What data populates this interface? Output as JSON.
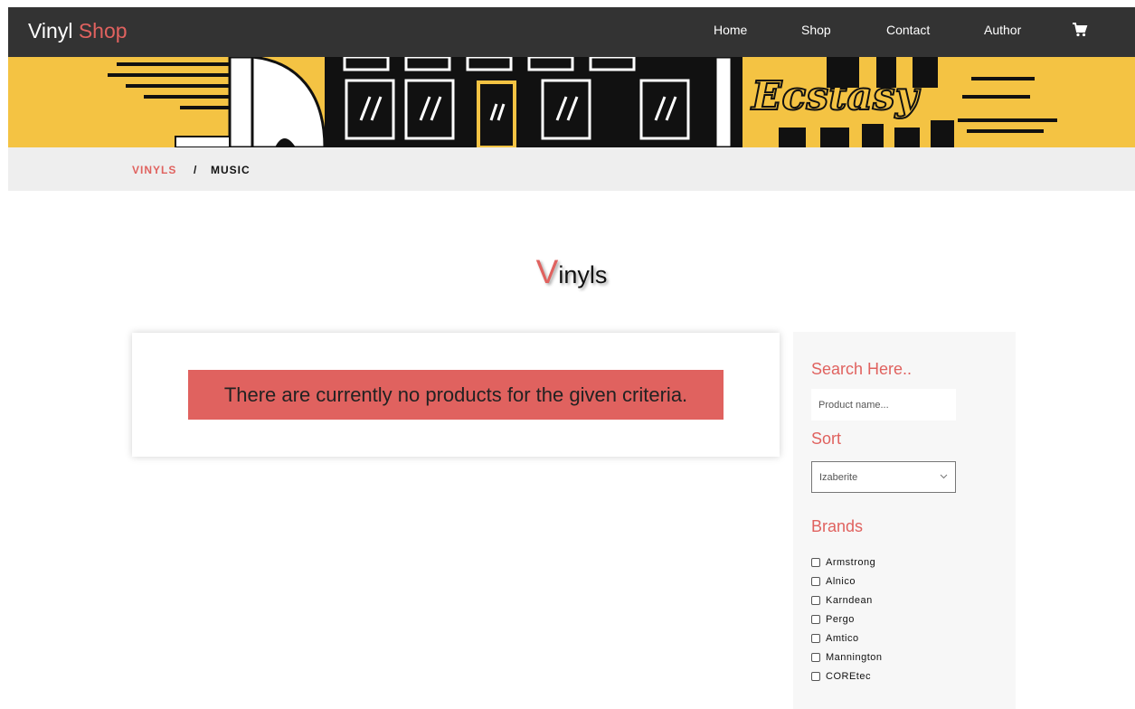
{
  "navbar": {
    "brand_main": "Vinyl",
    "brand_accent": "Shop",
    "links": [
      "Home",
      "Shop",
      "Contact",
      "Author"
    ],
    "cart_icon": "cart-icon"
  },
  "banner": {
    "script_text": "Ecstasy"
  },
  "breadcrumb": {
    "link": "VINYLS",
    "separator": "/",
    "current": "MUSIC"
  },
  "title": {
    "first_letter": "V",
    "rest": "inyls"
  },
  "results": {
    "message": "There are currently no products for the given criteria."
  },
  "sidebar": {
    "search_heading": "Search Here..",
    "search_placeholder": "Product name...",
    "sort_heading": "Sort",
    "sort_value": "Izaberite",
    "brands_heading": "Brands",
    "brands": [
      "Armstrong",
      "Alnico",
      "Karndean",
      "Pergo",
      "Amtico",
      "Mannington",
      "COREtec"
    ]
  },
  "colors": {
    "accent": "#e0625f",
    "navbar": "#333333",
    "banner": "#f4c343",
    "crumbbar": "#eeeeee",
    "sidebar": "#f7f7f7"
  }
}
